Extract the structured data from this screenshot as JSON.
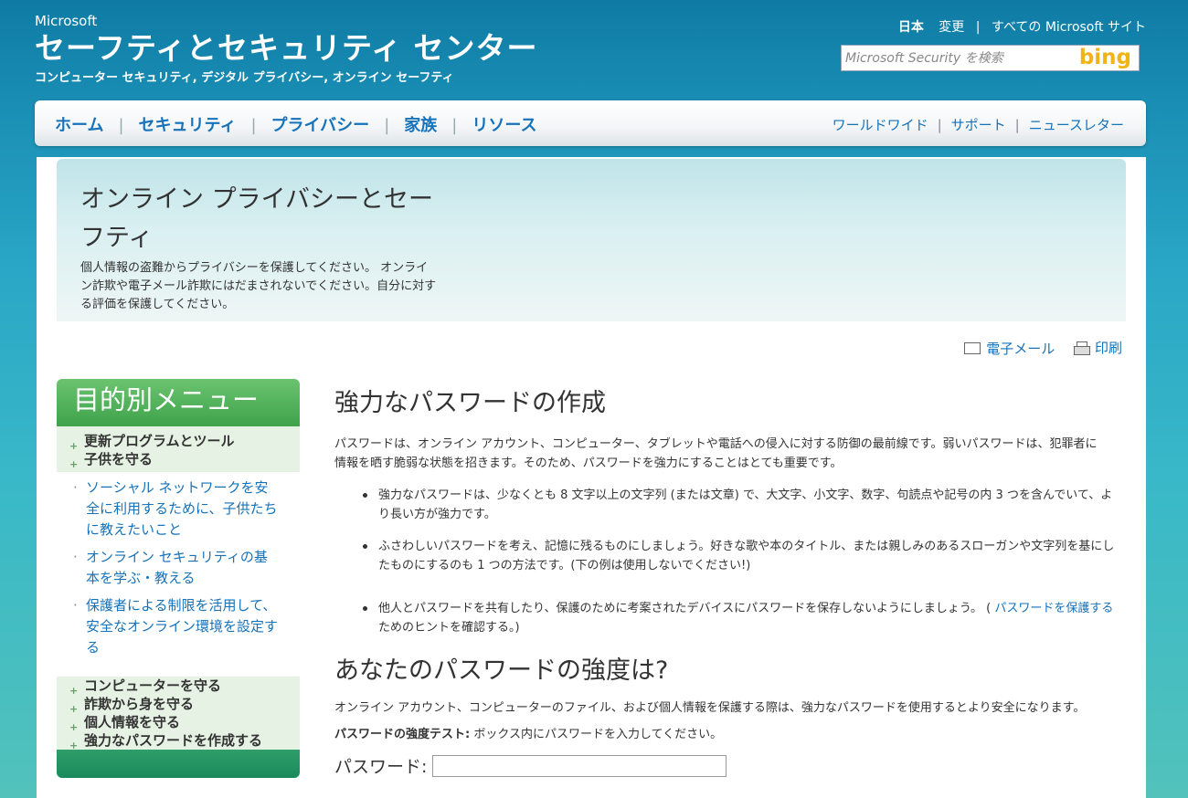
{
  "header": {
    "brand_small": "Microsoft",
    "brand_title": "セーフティとセキュリティ センター",
    "brand_subtitle": "コンピューター セキュリティ, デジタル プライバシー, オンライン セーフティ",
    "region": "日本",
    "change": "変更",
    "all_sites": "すべての Microsoft サイト",
    "search_placeholder": "Microsoft Security を検索",
    "search_brand": "bing"
  },
  "nav": {
    "main": [
      "ホーム",
      "セキュリティ",
      "プライバシー",
      "家族",
      "リソース"
    ],
    "util": [
      "ワールドワイド",
      "サポート",
      "ニュースレター"
    ]
  },
  "hero": {
    "title": "オンライン プライバシーとセーフティ",
    "description": "個人情報の盗難からプライバシーを保護してください。 オンライン詐欺や電子メール詐欺にはだまされないでください。自分に対する評価を保護してください。"
  },
  "actions": {
    "email": "電子メール",
    "print": "印刷"
  },
  "sidebar": {
    "heading": "目的別メニュー",
    "group_top": [
      "更新プログラムとツール",
      "子供を守る"
    ],
    "sub_items": [
      "ソーシャル ネットワークを安全に利用するために、子供たちに教えたいこと",
      "オンライン セキュリティの基本を学ぶ・教える",
      "保護者による制限を活用して、安全なオンライン環境を設定する"
    ],
    "group_bottom": [
      "コンピューターを守る",
      "詐欺から身を守る",
      "個人情報を守る",
      "強力なパスワードを作成する"
    ]
  },
  "article": {
    "title": "強力なパスワードの作成",
    "intro": "パスワードは、オンライン アカウント、コンピューター、タブレットや電話への侵入に対する防御の最前線です。弱いパスワードは、犯罪者に情報を晒す脆弱な状態を招きます。そのため、パスワードを強力にすることはとても重要です。",
    "bullet1": "強力なパスワードは、少なくとも 8 文字以上の文字列 (または文章) で、大文字、小文字、数字、句読点や記号の内 3 つを含んでいて、より長い方が強力です。",
    "bullet2": "ふさわしいパスワードを考え、記憶に残るものにしましょう。好きな歌や本のタイトル、または親しみのあるスローガンや文字列を基にしたものにするのも 1 つの方法です。(下の例は使用しないでください!)",
    "bullet3_pre": "他人とパスワードを共有したり、保護のために考案されたデバイスにパスワードを保存しないようにしましょう。 ( ",
    "bullet3_link": "パスワードを保護する",
    "bullet3_post": "ためのヒントを確認する。)",
    "title2": "あなたのパスワードの強度は?",
    "para2": "オンライン アカウント、コンピューターのファイル、および個人情報を保護する際は、強力なパスワードを使用するとより安全になります。",
    "test_label": "パスワードの強度テスト:",
    "test_text": " ボックス内にパスワードを入力してください。",
    "password_label": "パスワード:"
  }
}
